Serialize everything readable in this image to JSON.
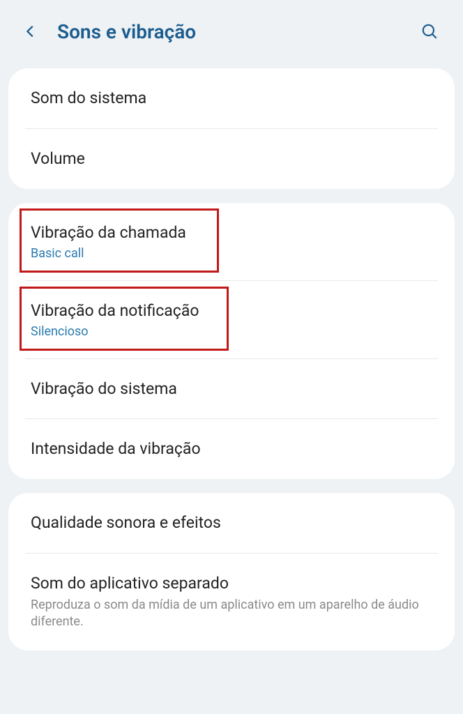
{
  "header": {
    "title": "Sons e vibração"
  },
  "group1": {
    "item1": {
      "title": "Som do sistema"
    },
    "item2": {
      "title": "Volume"
    }
  },
  "group2": {
    "item1": {
      "title": "Vibração da chamada",
      "subtitle": "Basic call"
    },
    "item2": {
      "title": "Vibração da notificação",
      "subtitle": "Silencioso"
    },
    "item3": {
      "title": "Vibração do sistema"
    },
    "item4": {
      "title": "Intensidade da vibração"
    }
  },
  "group3": {
    "item1": {
      "title": "Qualidade sonora e efeitos"
    },
    "item2": {
      "title": "Som do aplicativo separado",
      "description": "Reproduza o som da mídia de um aplicativo em um aparelho de áudio diferente."
    }
  }
}
